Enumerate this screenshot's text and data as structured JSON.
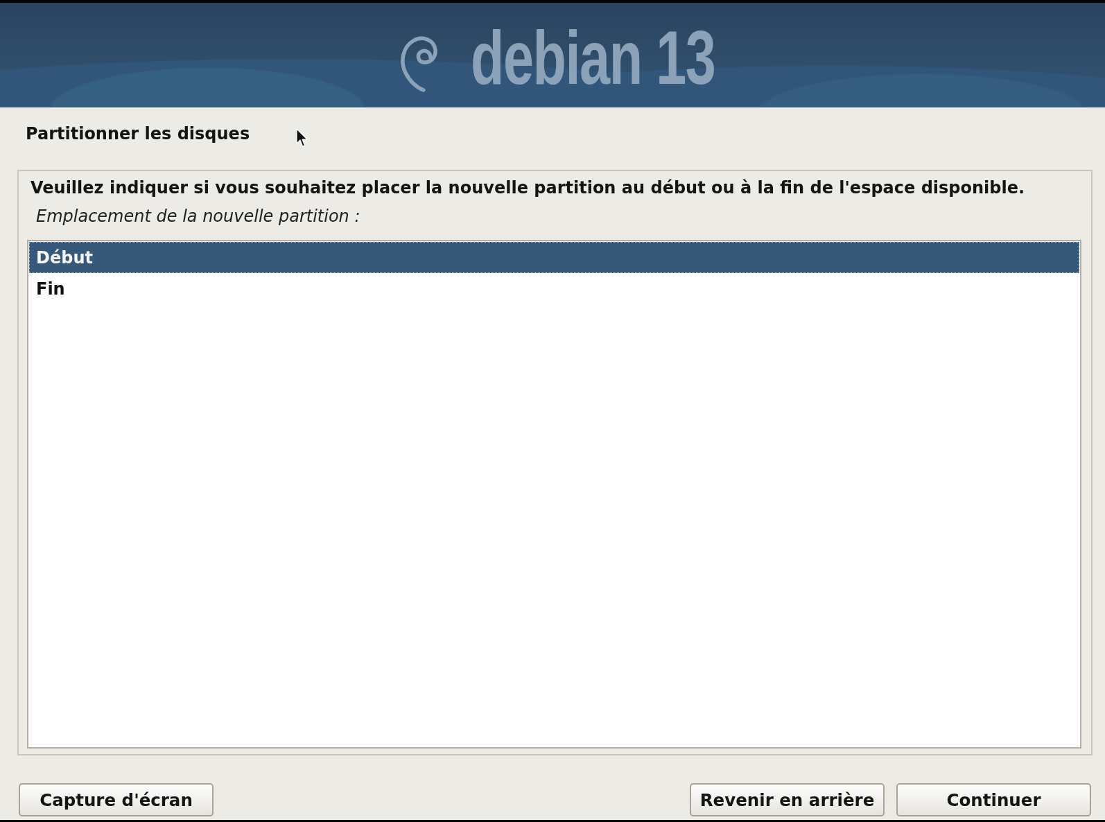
{
  "banner": {
    "logo_text": "debian 13"
  },
  "step_title": "Partitionner les disques",
  "question": "Veuillez indiquer si vous souhaitez placer la nouvelle partition au début ou à la fin de l'espace disponible.",
  "prompt": "Emplacement de la nouvelle partition :",
  "options": [
    {
      "label": "Début",
      "selected": true
    },
    {
      "label": "Fin",
      "selected": false
    }
  ],
  "left_buttons": [
    "Capture d'écran"
  ],
  "right_buttons": [
    "Revenir en arrière",
    "Continuer"
  ]
}
